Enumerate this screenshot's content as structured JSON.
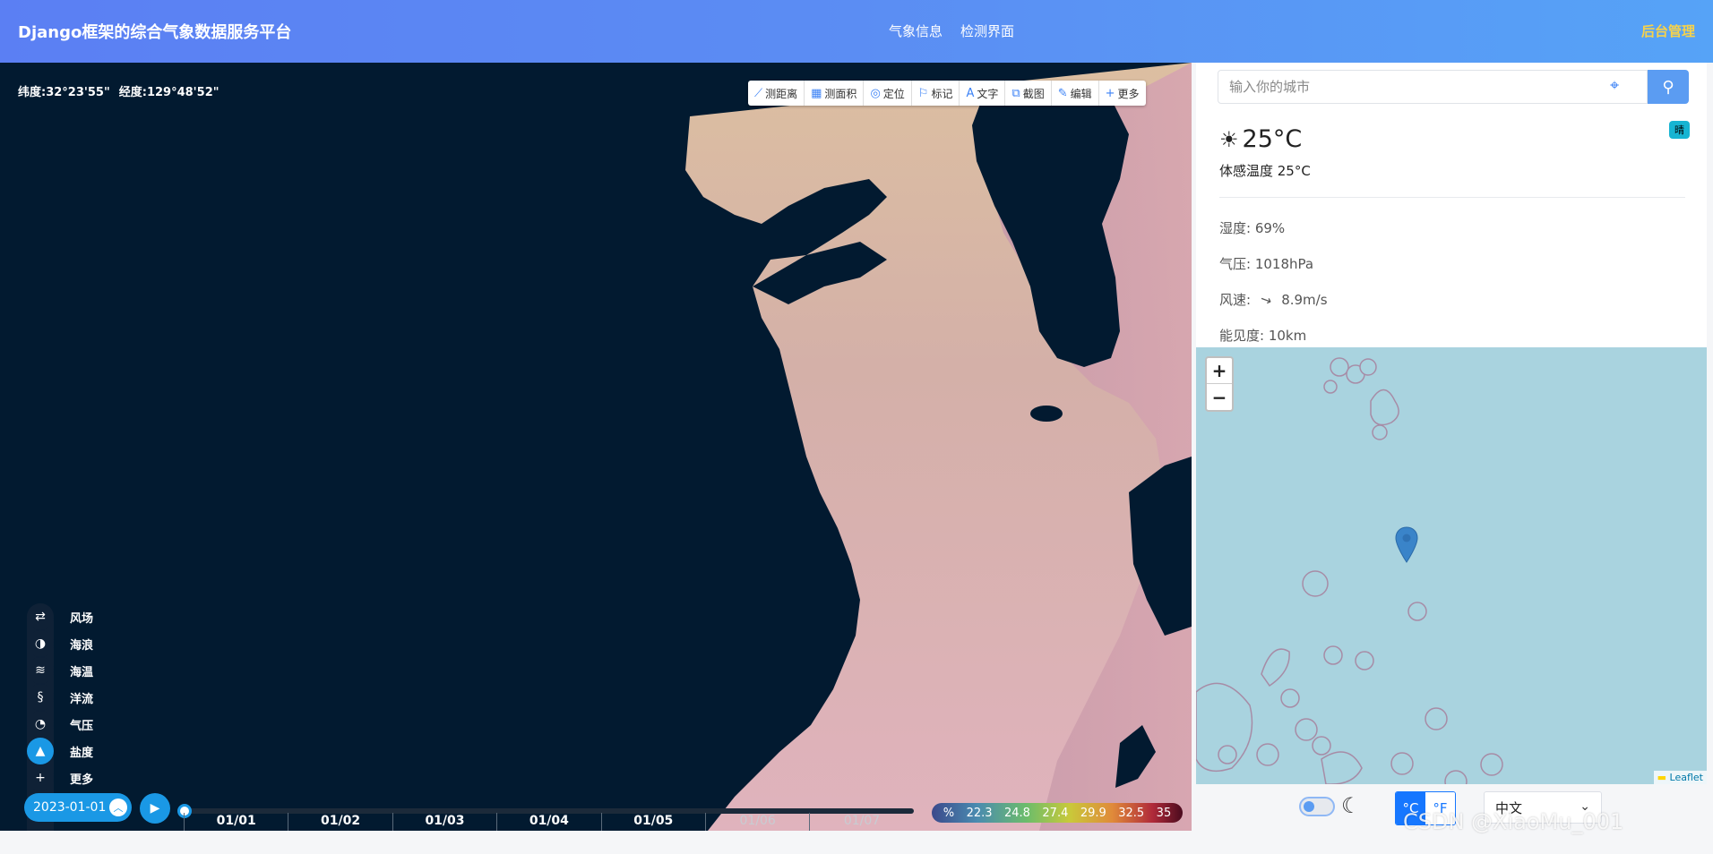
{
  "header": {
    "title": "Django框架的综合气象数据服务平台",
    "nav": [
      "气象信息",
      "检测界面"
    ],
    "admin": "后台管理"
  },
  "coords": {
    "lat_label": "纬度:",
    "lat": "32°23'55\"",
    "lon_label": "经度:",
    "lon": "129°48'52\""
  },
  "tools": [
    {
      "icon": "ruler-icon",
      "label": "测距离"
    },
    {
      "icon": "area-icon",
      "label": "测面积"
    },
    {
      "icon": "location-icon",
      "label": "定位"
    },
    {
      "icon": "flag-icon",
      "label": "标记"
    },
    {
      "icon": "text-icon",
      "label": "文字"
    },
    {
      "icon": "screenshot-icon",
      "label": "截图"
    },
    {
      "icon": "edit-icon",
      "label": "编辑"
    },
    {
      "icon": "plus-icon",
      "label": "更多"
    }
  ],
  "layers": [
    {
      "icon": "wind-icon",
      "label": "风场",
      "active": false
    },
    {
      "icon": "wave-icon",
      "label": "海浪",
      "active": false
    },
    {
      "icon": "sea-temp-icon",
      "label": "海温",
      "active": false
    },
    {
      "icon": "current-icon",
      "label": "洋流",
      "active": false
    },
    {
      "icon": "pressure-icon",
      "label": "气压",
      "active": false
    },
    {
      "icon": "salinity-icon",
      "label": "盐度",
      "active": true
    },
    {
      "icon": "plus-icon",
      "label": "更多",
      "active": false
    }
  ],
  "timeline": {
    "date": "2023-01-01",
    "ticks": [
      "01/01",
      "01/02",
      "01/03",
      "01/04",
      "01/05",
      "01/06",
      "01/07"
    ]
  },
  "legend": {
    "unit": "%",
    "values": [
      "22.3",
      "24.8",
      "27.4",
      "29.9",
      "32.5",
      "35"
    ]
  },
  "search": {
    "placeholder": "输入你的城市"
  },
  "weather": {
    "temp": "25°C",
    "badge": "晴",
    "feels": "体感温度 25°C",
    "humidity": "湿度: 69%",
    "pressure": "气压: 1018hPa",
    "wind_label": "风速:",
    "wind_value": "8.9m/s",
    "visibility": "能见度: 10km"
  },
  "map_right": {
    "zoom_in": "+",
    "zoom_out": "−",
    "attribution": "Leaflet"
  },
  "controls": {
    "unit_c": "°C",
    "unit_f": "°F",
    "language": "中文"
  },
  "watermark": "CSDN @XiaoMu_001"
}
